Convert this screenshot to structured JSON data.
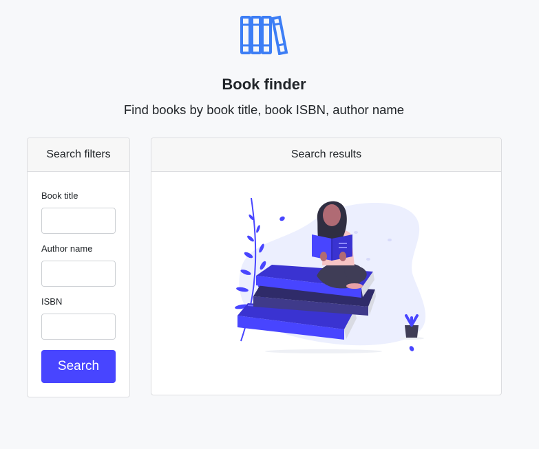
{
  "app": {
    "logo_icon": "bookshelf-icon",
    "title": "Book finder",
    "subtitle": "Find books by book title, book ISBN, author name"
  },
  "filters": {
    "header": "Search filters",
    "fields": [
      {
        "label": "Book title",
        "value": "",
        "placeholder": ""
      },
      {
        "label": "Author name",
        "value": "",
        "placeholder": ""
      },
      {
        "label": "ISBN",
        "value": "",
        "placeholder": ""
      }
    ],
    "search_button": "Search"
  },
  "results": {
    "header": "Search results",
    "illustration": "woman-reading-on-books-illustration"
  },
  "colors": {
    "accent": "#4845ff",
    "logo": "#3d7ef5",
    "page_bg": "#f7f8fa"
  }
}
